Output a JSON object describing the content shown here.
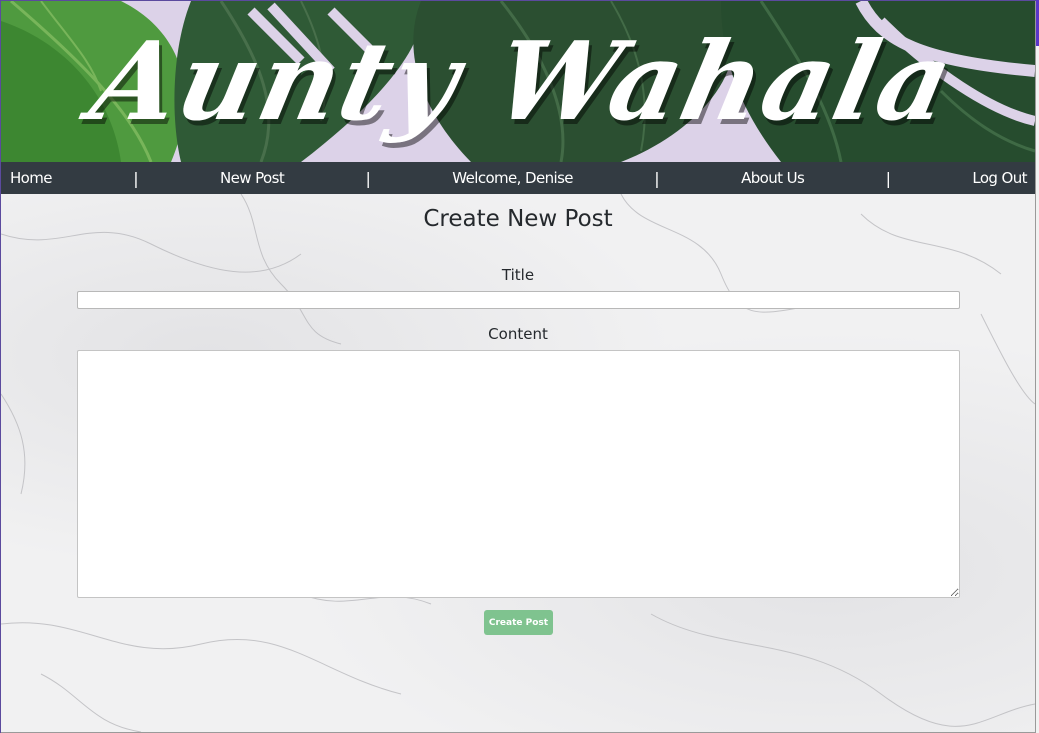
{
  "site": {
    "banner_title": "Aunty Wahala"
  },
  "nav": {
    "items": [
      {
        "label": "Home"
      },
      {
        "label": "New Post"
      },
      {
        "label": "Welcome, Denise"
      },
      {
        "label": "About Us"
      },
      {
        "label": "Log Out"
      }
    ],
    "separator": "|"
  },
  "form": {
    "heading": "Create New Post",
    "title_label": "Title",
    "title_value": "",
    "content_label": "Content",
    "content_value": "",
    "submit_label": "Create Post"
  },
  "colors": {
    "nav_bg": "#333b42",
    "button_bg": "#7fc38f",
    "banner_bg": "#d9cfe6",
    "leaf_green": "#3f8a3a"
  }
}
